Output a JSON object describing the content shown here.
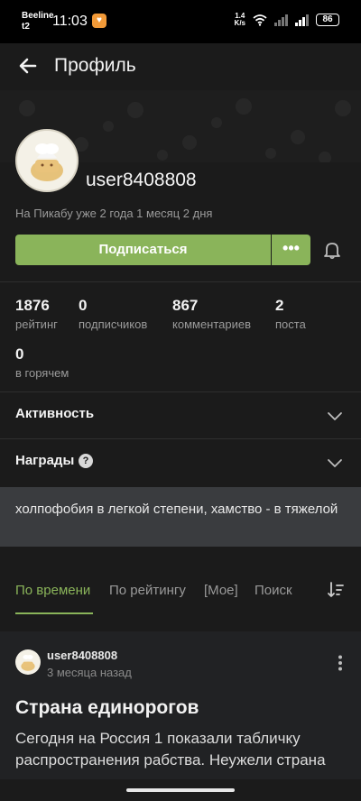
{
  "status_bar": {
    "carrier_top": "Beeline",
    "carrier_bottom": "t2",
    "time": "11:03",
    "net_speed_value": "1.4",
    "net_speed_unit": "K/s",
    "battery": "86"
  },
  "header": {
    "title": "Профиль"
  },
  "profile": {
    "username": "user8408808",
    "member_since": "На Пикабу уже 2 года 1 месяц 2 дня",
    "subscribe_label": "Подписаться",
    "more_label": "•••"
  },
  "stats": [
    {
      "value": "1876",
      "label": "рейтинг"
    },
    {
      "value": "0",
      "label": "подписчиков"
    },
    {
      "value": "867",
      "label": "комментариев"
    },
    {
      "value": "2",
      "label": "поста"
    },
    {
      "value": "0",
      "label": "в горячем"
    }
  ],
  "sections": {
    "activity_label": "Активность",
    "awards_label": "Награды",
    "awards_help": "?"
  },
  "bio": "холпофобия в легкой степени, хамство - в тяжелой",
  "tabs": [
    {
      "label": "По времени",
      "active": true
    },
    {
      "label": "По рейтингу",
      "active": false
    },
    {
      "label": "[Мое]",
      "active": false
    },
    {
      "label": "Поиск",
      "active": false
    }
  ],
  "post": {
    "author": "user8408808",
    "time": "3 месяца назад",
    "title": "Страна единорогов",
    "body": "Сегодня на Россия 1 показали табличку распространения рабства. Неужели страна"
  },
  "colors": {
    "accent": "#8ab45a",
    "background": "#1b1b1b",
    "bio_background": "#3a3c3f"
  },
  "icons": {
    "back": "arrow-left-icon",
    "bell": "bell-icon",
    "chevron": "chevron-down-icon",
    "sort": "sort-icon",
    "kebab": "more-vertical-icon"
  }
}
